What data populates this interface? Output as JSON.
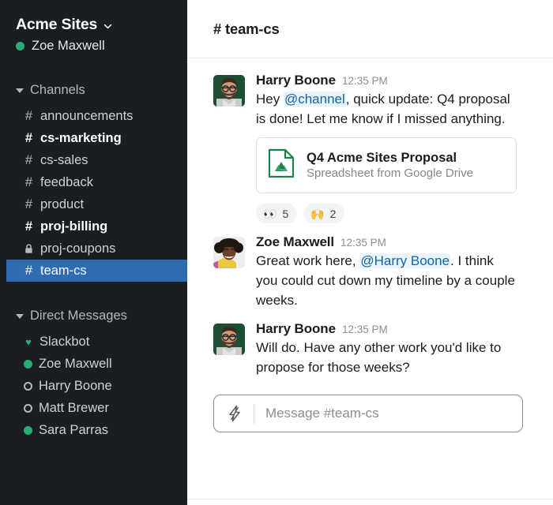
{
  "workspace": {
    "name": "Acme Sites",
    "chevron_icon": "chevron-down-icon",
    "current_user": "Zoe Maxwell",
    "presence_color": "#2bac76"
  },
  "sidebar": {
    "bg_color": "#1a1d21",
    "selected_color": "#2f6bb0",
    "sections": [
      {
        "title": "Channels",
        "items": [
          {
            "label": "announcements",
            "prefix": "#",
            "icon": "hash-icon",
            "unread": false,
            "selected": false
          },
          {
            "label": "cs-marketing",
            "prefix": "#",
            "icon": "hash-icon",
            "unread": true,
            "selected": false
          },
          {
            "label": "cs-sales",
            "prefix": "#",
            "icon": "hash-icon",
            "unread": false,
            "selected": false
          },
          {
            "label": "feedback",
            "prefix": "#",
            "icon": "hash-icon",
            "unread": false,
            "selected": false
          },
          {
            "label": "product",
            "prefix": "#",
            "icon": "hash-icon",
            "unread": false,
            "selected": false
          },
          {
            "label": "proj-billing",
            "prefix": "#",
            "icon": "hash-icon",
            "unread": true,
            "selected": false
          },
          {
            "label": "proj-coupons",
            "prefix": "",
            "icon": "lock-icon",
            "unread": false,
            "selected": false
          },
          {
            "label": "team-cs",
            "prefix": "#",
            "icon": "hash-icon",
            "unread": false,
            "selected": true
          }
        ]
      },
      {
        "title": "Direct Messages",
        "items": [
          {
            "label": "Slackbot",
            "presence": "heart",
            "icon": "heart-icon"
          },
          {
            "label": "Zoe Maxwell",
            "presence": "online",
            "icon": "presence-online-icon"
          },
          {
            "label": "Harry Boone",
            "presence": "offline",
            "icon": "presence-offline-icon"
          },
          {
            "label": "Matt Brewer",
            "presence": "offline",
            "icon": "presence-offline-icon"
          },
          {
            "label": "Sara Parras",
            "presence": "online",
            "icon": "presence-online-icon"
          }
        ]
      }
    ]
  },
  "channel": {
    "title": "# team-cs",
    "name": "team-cs"
  },
  "messages": [
    {
      "author": "Harry Boone",
      "time": "12:35 PM",
      "avatar": "harry",
      "text_before": "Hey ",
      "mention": "@channel",
      "text_after": ", quick update: Q4 proposal is done! Let me know if I missed anything.",
      "attachment": {
        "name": "Q4 Acme Sites Proposal",
        "subtitle": "Spreadsheet from Google Drive",
        "icon": "google-drive-file-icon",
        "icon_color": "#1a7f4b"
      },
      "reactions": [
        {
          "emoji": "👀",
          "name": "eyes-reaction",
          "count": "5"
        },
        {
          "emoji": "🙌",
          "name": "raised-hands-reaction",
          "count": "2"
        }
      ]
    },
    {
      "author": "Zoe Maxwell",
      "time": "12:35 PM",
      "avatar": "zoe",
      "text_before": "Great work here, ",
      "mention": "@Harry Boone",
      "text_after": ". I think you could cut down my timeline by a couple weeks."
    },
    {
      "author": "Harry Boone",
      "time": "12:35 PM",
      "avatar": "harry",
      "text_before": "Will do. Have any other work you'd like to propose for those weeks?",
      "mention": "",
      "text_after": ""
    }
  ],
  "composer": {
    "placeholder": "Message #team-cs",
    "value": "",
    "bolt_icon": "lightning-bolt-icon"
  },
  "colors": {
    "mention_text": "#1264a3",
    "mention_bg": "#e8f3fc",
    "text_primary": "#1d1c1d",
    "text_muted": "#8d8d8e"
  }
}
